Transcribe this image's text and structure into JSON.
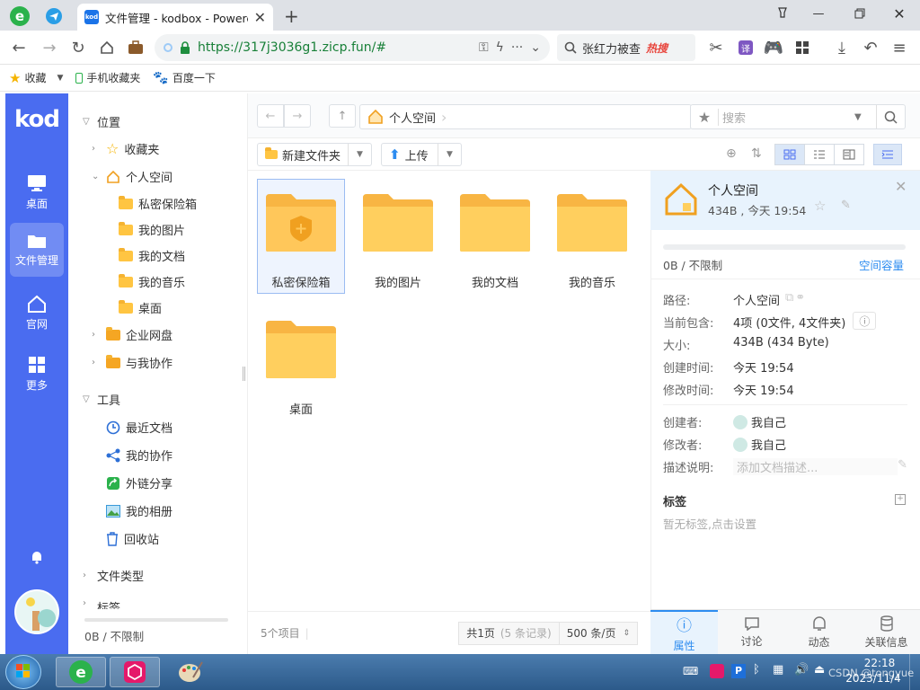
{
  "browser": {
    "tab_title": "文件管理 - kodbox - Powere",
    "tab_favicon": "kod",
    "url": "https://317j3036g1.zicp.fun/#",
    "search_hint": "张红力被查",
    "search_hot": "热搜",
    "bookmarks": [
      {
        "label": "收藏"
      },
      {
        "label": "手机收藏夹"
      },
      {
        "label": "百度一下"
      }
    ],
    "extension_badge": "译"
  },
  "rail": {
    "logo": "kod",
    "items": [
      {
        "label": "桌面"
      },
      {
        "label": "文件管理"
      },
      {
        "label": "官网"
      },
      {
        "label": "更多"
      }
    ]
  },
  "tree": {
    "location_label": "位置",
    "favorites": "收藏夹",
    "personal_space": "个人空间",
    "personal_children": [
      "私密保险箱",
      "我的图片",
      "我的文档",
      "我的音乐",
      "桌面"
    ],
    "enterprise": "企业网盘",
    "collab": "与我协作",
    "tools_label": "工具",
    "tools": [
      "最近文档",
      "我的协作",
      "外链分享",
      "我的相册",
      "回收站"
    ],
    "file_types": "文件类型",
    "tags": "标签",
    "quota": "0B / 不限制"
  },
  "main": {
    "breadcrumb": "个人空间",
    "search_placeholder": "搜索",
    "new_folder": "新建文件夹",
    "upload": "上传",
    "items": [
      "私密保险箱",
      "我的图片",
      "我的文档",
      "我的音乐",
      "桌面"
    ],
    "status_count": "5个项目",
    "page_info": "共1页",
    "page_records": "(5 条记录)",
    "page_size": "500 条/页"
  },
  "panel": {
    "title": "个人空间",
    "subtitle": "434B , 今天 19:54",
    "quota": "0B / 不限制",
    "quota_link": "空间容量",
    "props": [
      {
        "k": "路径:",
        "v": "个人空间"
      },
      {
        "k": "当前包含:",
        "v": "4项 (0文件, 4文件夹)"
      },
      {
        "k": "大小:",
        "v": "434B (434 Byte)"
      },
      {
        "k": "创建时间:",
        "v": "今天 19:54"
      },
      {
        "k": "修改时间:",
        "v": "今天 19:54"
      }
    ],
    "creator_label": "创建者:",
    "creator": "我自己",
    "modifier_label": "修改者:",
    "modifier": "我自己",
    "desc_label": "描述说明:",
    "desc_placeholder": "添加文档描述...",
    "tags_title": "标签",
    "tags_empty": "暂无标签,点击设置",
    "tabs": [
      "属性",
      "讨论",
      "动态",
      "关联信息"
    ]
  },
  "taskbar": {
    "time": "22:18",
    "date": "2023/11/4",
    "watermark": "CSDN @tongyue"
  }
}
